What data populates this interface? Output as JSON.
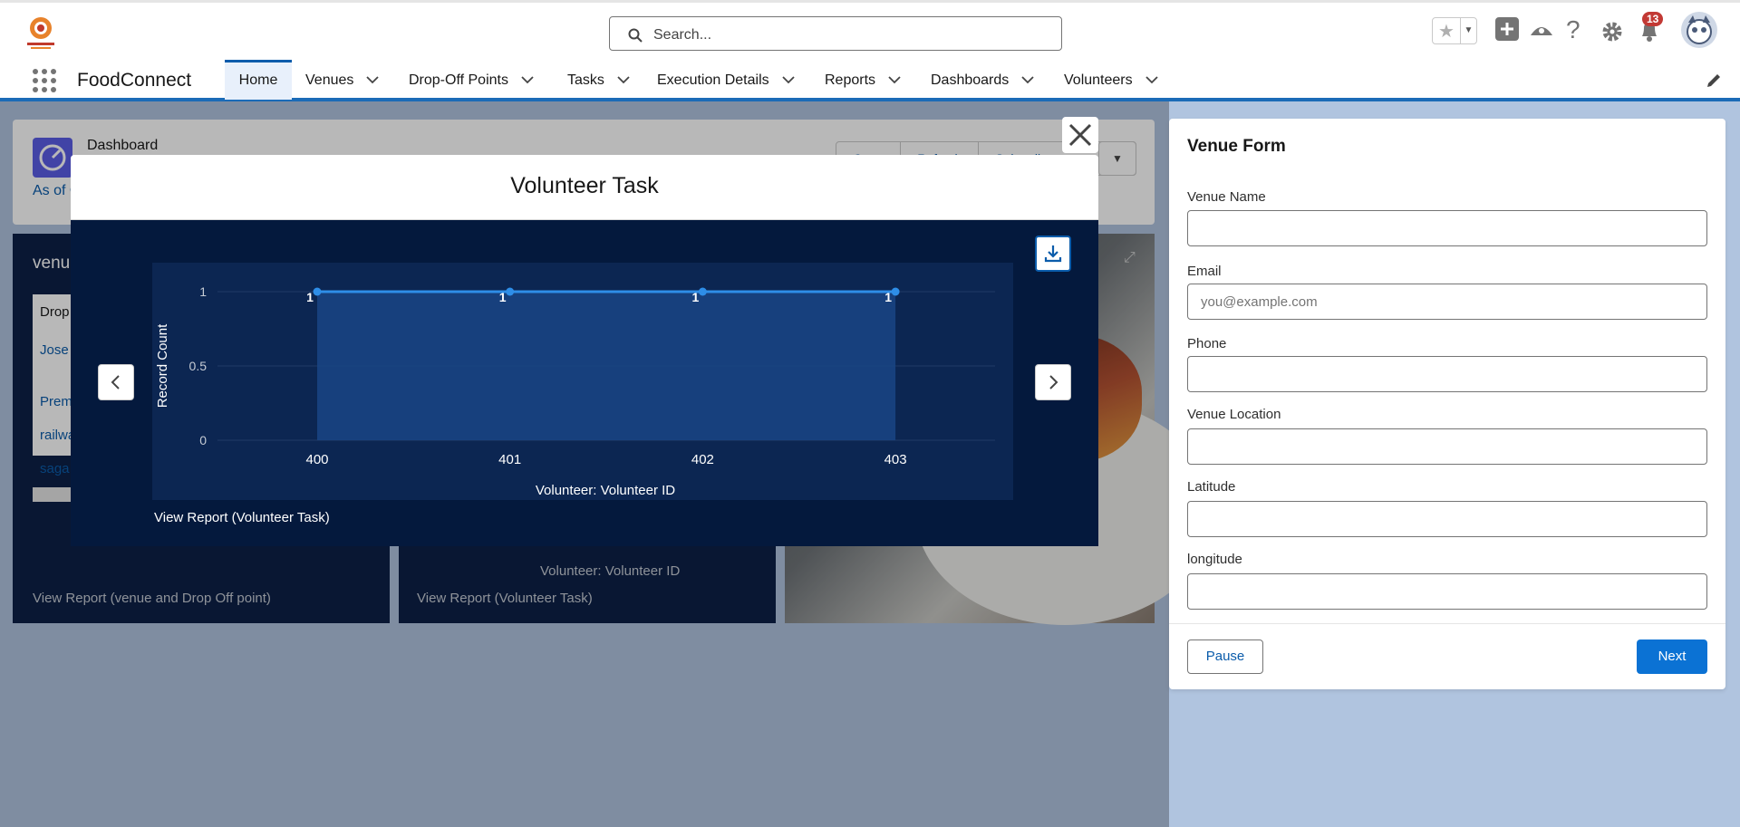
{
  "header": {
    "search_placeholder": "Search...",
    "notification_count": "13"
  },
  "nav": {
    "app_name": "FoodConnect",
    "tabs": [
      {
        "label": "Home",
        "active": true
      },
      {
        "label": "Venues"
      },
      {
        "label": "Drop-Off Points"
      },
      {
        "label": "Tasks"
      },
      {
        "label": "Execution Details"
      },
      {
        "label": "Reports"
      },
      {
        "label": "Dashboards"
      },
      {
        "label": "Volunteers"
      }
    ]
  },
  "dashboard": {
    "label": "Dashboard",
    "as_of": "As of C",
    "buttons": [
      "Open",
      "Refresh",
      "Subscribe"
    ]
  },
  "background_panels": {
    "panel1_title": "venu",
    "panel1_header": "Drop",
    "panel1_rows": [
      "Jose",
      "Prem",
      "railwa",
      "saga"
    ],
    "panel1_link": "View Report (venue and Drop Off point)",
    "panel2_axis": "Volunteer: Volunteer ID",
    "panel2_link": "View Report (Volunteer Task)"
  },
  "modal": {
    "title": "Volunteer Task",
    "view_report": "View Report (Volunteer Task)"
  },
  "chart_data": {
    "type": "area",
    "categories": [
      "400",
      "401",
      "402",
      "403"
    ],
    "values": [
      1,
      1,
      1,
      1
    ],
    "data_labels": [
      "1",
      "1",
      "1",
      "1"
    ],
    "ylabel": "Record Count",
    "xlabel": "Volunteer: Volunteer ID",
    "ylim": [
      0,
      1
    ],
    "yticks": [
      "0",
      "0.5",
      "1"
    ],
    "grid": true,
    "line_color": "#2e8ee8"
  },
  "form": {
    "title": "Venue Form",
    "fields": [
      {
        "label": "Venue Name",
        "placeholder": ""
      },
      {
        "label": "Email",
        "placeholder": "you@example.com"
      },
      {
        "label": "Phone",
        "placeholder": ""
      },
      {
        "label": "Venue Location",
        "placeholder": ""
      },
      {
        "label": "Latitude",
        "placeholder": ""
      },
      {
        "label": "longitude",
        "placeholder": ""
      }
    ],
    "pause_label": "Pause",
    "next_label": "Next"
  }
}
